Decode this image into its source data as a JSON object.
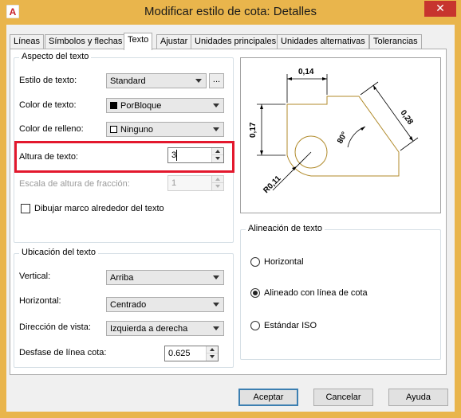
{
  "window": {
    "title": "Modificar estilo de cota: Detalles",
    "close_label": "✕"
  },
  "tabs": [
    {
      "label": "Líneas"
    },
    {
      "label": "Símbolos y flechas"
    },
    {
      "label": "Texto"
    },
    {
      "label": "Ajustar"
    },
    {
      "label": "Unidades principales"
    },
    {
      "label": "Unidades alternativas"
    },
    {
      "label": "Tolerancias"
    }
  ],
  "aspecto": {
    "title": "Aspecto del texto",
    "estilo_label": "Estilo de texto:",
    "estilo_value": "Standard",
    "estilo_button": "...",
    "color_label": "Color de texto:",
    "color_value": "PorBloque",
    "color_swatch": "#000000",
    "relleno_label": "Color de relleno:",
    "relleno_value": "Ninguno",
    "altura_label": "Altura de texto:",
    "altura_value": "3",
    "escala_label": "Escala de altura de fracción:",
    "escala_value": "1",
    "marco_label": "Dibujar marco alrededor del texto",
    "marco_checked": false
  },
  "ubicacion": {
    "title": "Ubicación del texto",
    "vertical_label": "Vertical:",
    "vertical_value": "Arriba",
    "horizontal_label": "Horizontal:",
    "horizontal_value": "Centrado",
    "direccion_label": "Dirección de vista:",
    "direccion_value": "Izquierda a derecha",
    "desfase_label": "Desfase de línea cota:",
    "desfase_value": "0.625"
  },
  "preview": {
    "dim_top": "0,14",
    "dim_left": "0,17",
    "dim_right": "0,28",
    "dim_angle": "80°",
    "dim_radius": "R0,11"
  },
  "alineacion": {
    "title": "Alineación de texto",
    "options": [
      {
        "label": "Horizontal",
        "selected": false
      },
      {
        "label": "Alineado con línea de cota",
        "selected": true
      },
      {
        "label": "Estándar ISO",
        "selected": false
      }
    ]
  },
  "buttons": {
    "accept": "Aceptar",
    "cancel": "Cancelar",
    "help": "Ayuda"
  },
  "colors": {
    "titlebar": "#e9b54c",
    "highlight": "#e3182d",
    "geometry": "#b08a2a",
    "dimension": "#000000"
  }
}
